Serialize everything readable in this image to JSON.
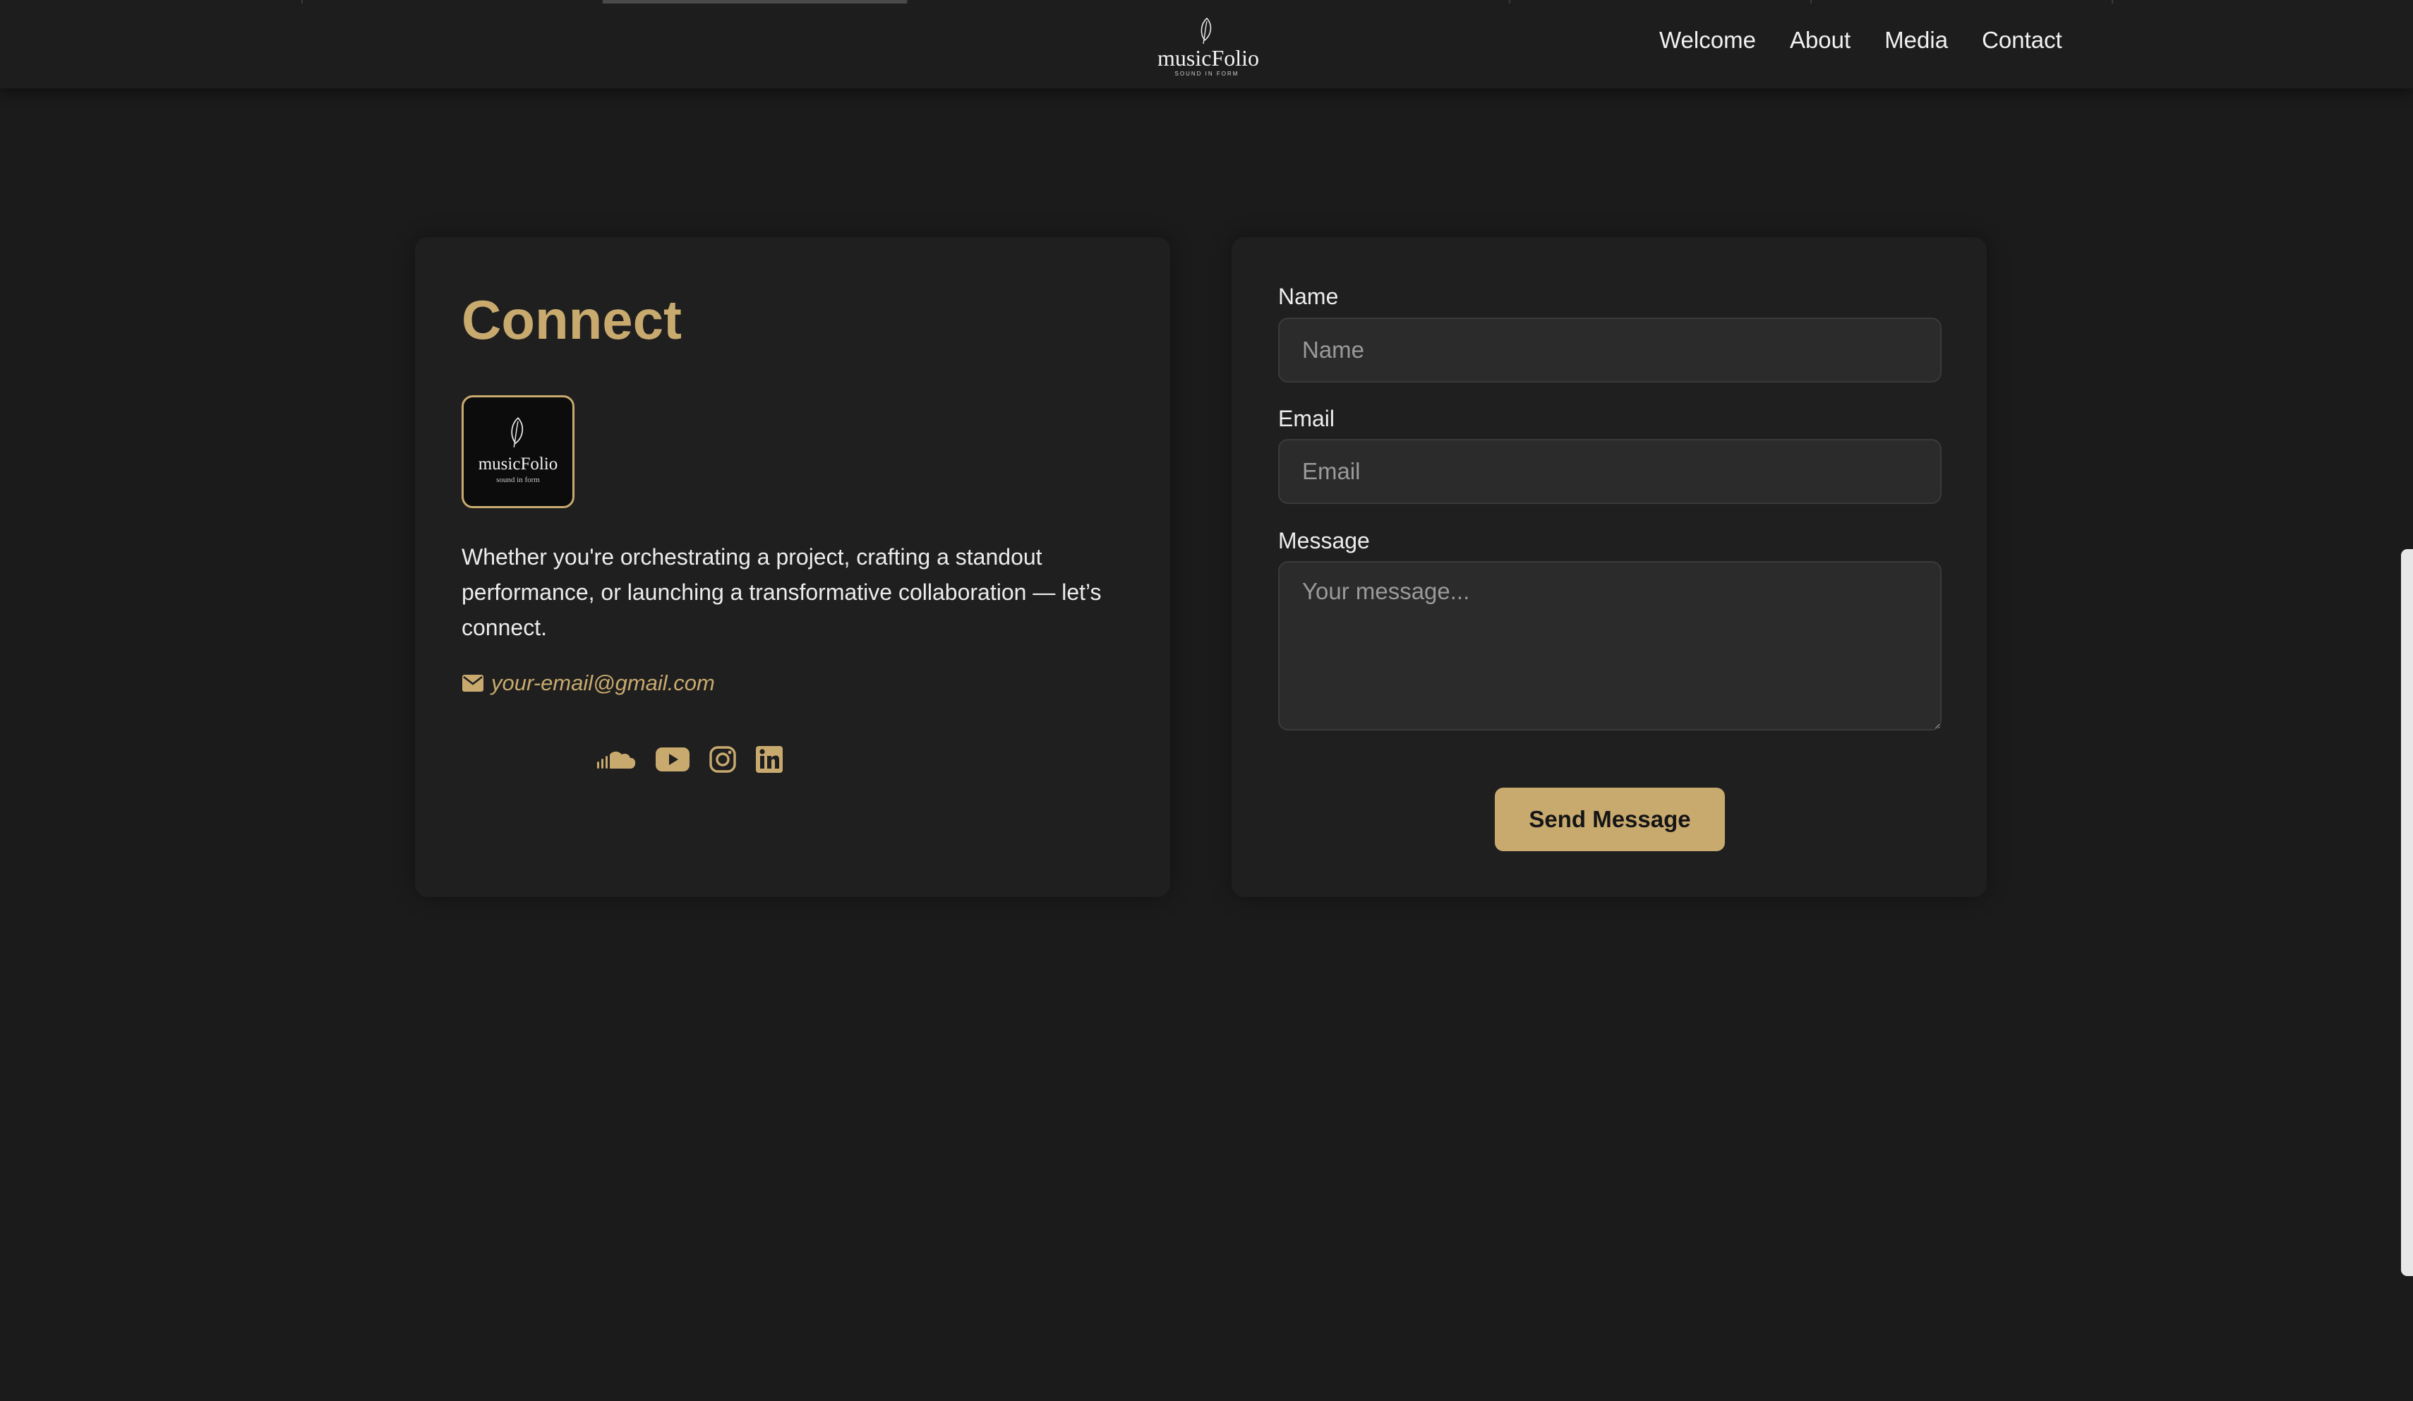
{
  "nav": {
    "brand": "musicFolio",
    "tagline": "SOUND IN FORM",
    "links": [
      "Welcome",
      "About",
      "Media",
      "Contact"
    ]
  },
  "connect": {
    "title": "Connect",
    "avatar_brand": "musicFolio",
    "avatar_tagline": "sound in form",
    "intro": "Whether you're orchestrating a project, crafting a standout performance, or launching a transformative collaboration — let’s connect.",
    "email": "your-email@gmail.com",
    "socials": [
      "soundcloud-icon",
      "youtube-icon",
      "instagram-icon",
      "linkedin-icon"
    ]
  },
  "form": {
    "name_label": "Name",
    "name_placeholder": "Name",
    "email_label": "Email",
    "email_placeholder": "Email",
    "message_label": "Message",
    "message_placeholder": "Your message...",
    "submit_label": "Send Message"
  },
  "colors": {
    "accent": "#c8aa6e",
    "background": "#1b1b1b",
    "card": "#1f1f1f",
    "input": "#2b2b2b"
  }
}
